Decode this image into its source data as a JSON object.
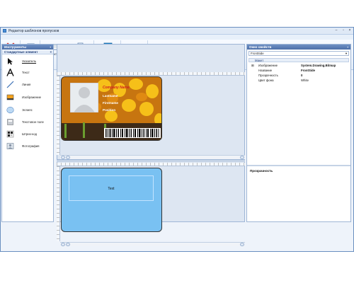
{
  "window": {
    "title": "Редактор шаблонов пропусков"
  },
  "ribbon": {
    "groups": [
      {
        "label": "Правка",
        "buttons": [
          {
            "label": "Удалить"
          }
        ]
      },
      {
        "label": "Макет",
        "buttons": [
          {
            "label": "Размер пропуска"
          }
        ]
      },
      {
        "label": "Ориентация",
        "buttons": [
          {
            "label": "Горизонтально"
          },
          {
            "label": "Вертикально"
          }
        ]
      },
      {
        "label": "Рабочая область",
        "buttons": [
          {
            "label": "Разделение"
          }
        ]
      },
      {
        "label": "Выравнивание",
        "buttons": []
      }
    ]
  },
  "toolbox": {
    "title": "Инструменты",
    "section": "Стандартные элемент",
    "tools": [
      {
        "label": "Указатель",
        "icon": "pointer-icon"
      },
      {
        "label": "Текст",
        "icon": "text-icon"
      },
      {
        "label": "Линия",
        "icon": "line-icon"
      },
      {
        "label": "Изображение",
        "icon": "image-icon"
      },
      {
        "label": "Эллипс",
        "icon": "ellipse-icon"
      },
      {
        "label": "Текстовое поле",
        "icon": "textbox-icon"
      },
      {
        "label": "Штрих-код",
        "icon": "barcode-icon"
      },
      {
        "label": "Фотография",
        "icon": "photo-icon"
      }
    ]
  },
  "card_front": {
    "line1": "Company Name",
    "line2": "Lastname",
    "line3": "Firstname",
    "line4": "Position"
  },
  "card_back": {
    "text": "Text"
  },
  "properties": {
    "title": "Окно свойств",
    "selected_object": "FrontSide",
    "category": "Макет",
    "rows": [
      {
        "key": "Изображение",
        "value": "System.Drawing.Bitmap",
        "bold": true
      },
      {
        "key": "Название",
        "value": "FrontSide",
        "bold": true
      },
      {
        "key": "Прозрачность",
        "value": "0",
        "bold": true
      },
      {
        "key": "Цвет фона",
        "value": "White",
        "bold": false
      }
    ],
    "description_title": "Прозрачность"
  },
  "colors": {
    "accent": "#4d6fa8",
    "card_back_fill": "#79c1f2",
    "card_front_fill": "#d27b14"
  }
}
